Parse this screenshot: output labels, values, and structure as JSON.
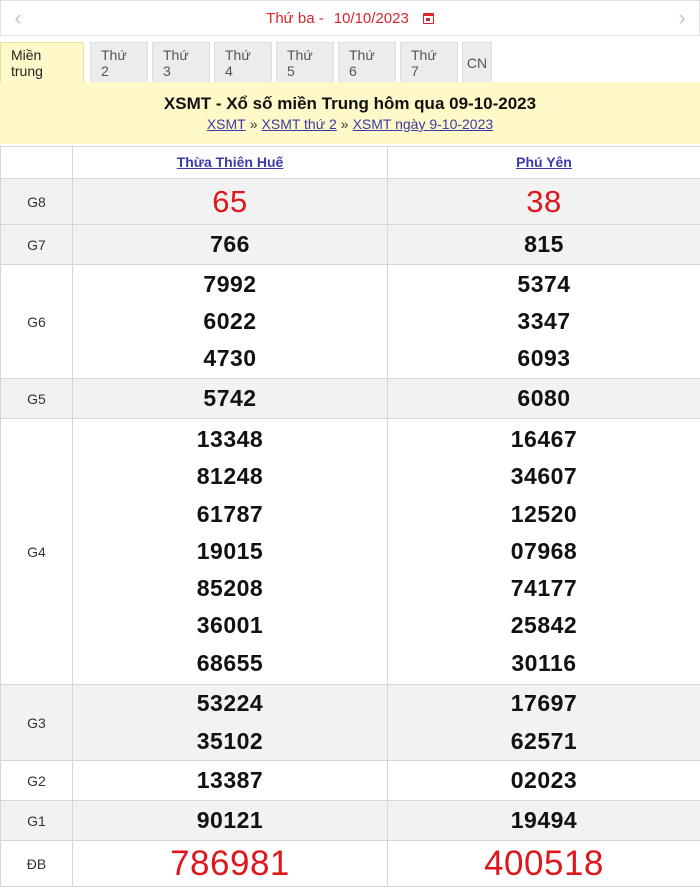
{
  "date_bar": {
    "prev_icon": "chevron-left-icon",
    "day_label": "Thứ ba -",
    "date_value": "10/10/2023",
    "calendar_icon": "calendar-icon",
    "next_icon": "chevron-right-icon",
    "accent_color": "#d8262c"
  },
  "tabs": [
    {
      "label": "Miền trung",
      "active": true
    },
    {
      "label": "Thứ 2"
    },
    {
      "label": "Thứ 3"
    },
    {
      "label": "Thứ 4"
    },
    {
      "label": "Thứ 5"
    },
    {
      "label": "Thứ 6"
    },
    {
      "label": "Thứ 7"
    },
    {
      "label": "CN"
    }
  ],
  "headline": {
    "title": "XSMT - Xổ số miền Trung hôm qua 09-10-2023",
    "breadcrumb": [
      "XSMT",
      "XSMT thứ 2",
      "XSMT ngày 9-10-2023"
    ],
    "separator": "»",
    "background": "#fff8c8"
  },
  "table": {
    "provinces": [
      "Thừa Thiên Huế",
      "Phú Yên"
    ],
    "prizes": {
      "g8": {
        "label": "G8",
        "col1": [
          "65"
        ],
        "col2": [
          "38"
        ]
      },
      "g7": {
        "label": "G7",
        "col1": [
          "766"
        ],
        "col2": [
          "815"
        ]
      },
      "g6": {
        "label": "G6",
        "col1": [
          "7992",
          "6022",
          "4730"
        ],
        "col2": [
          "5374",
          "3347",
          "6093"
        ]
      },
      "g5": {
        "label": "G5",
        "col1": [
          "5742"
        ],
        "col2": [
          "6080"
        ]
      },
      "g4": {
        "label": "G4",
        "col1": [
          "13348",
          "81248",
          "61787",
          "19015",
          "85208",
          "36001",
          "68655"
        ],
        "col2": [
          "16467",
          "34607",
          "12520",
          "07968",
          "74177",
          "25842",
          "30116"
        ]
      },
      "g3": {
        "label": "G3",
        "col1": [
          "53224",
          "35102"
        ],
        "col2": [
          "17697",
          "62571"
        ]
      },
      "g2": {
        "label": "G2",
        "col1": [
          "13387"
        ],
        "col2": [
          "02023"
        ]
      },
      "g1": {
        "label": "G1",
        "col1": [
          "90121"
        ],
        "col2": [
          "19494"
        ]
      },
      "db": {
        "label": "ĐB",
        "col1": [
          "786981"
        ],
        "col2": [
          "400518"
        ]
      }
    },
    "highlight_color": "#e0161d"
  }
}
